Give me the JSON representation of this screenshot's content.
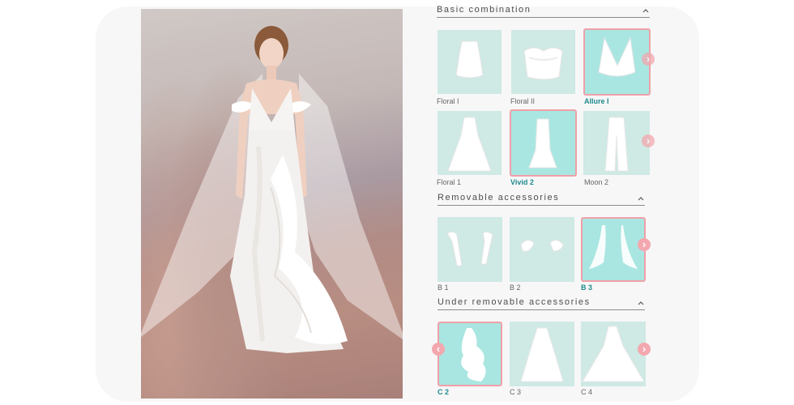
{
  "sections": {
    "basic": {
      "title": "Basic combination"
    },
    "removable": {
      "title": "Removable accessories"
    },
    "under": {
      "title": "Under removable accessories"
    }
  },
  "tops": [
    {
      "label": "Floral I",
      "selected": false,
      "icon": "halter-top-icon"
    },
    {
      "label": "Floral II",
      "selected": false,
      "icon": "bustier-top-icon"
    },
    {
      "label": "Allure I",
      "selected": true,
      "icon": "v-neck-top-icon"
    }
  ],
  "bottoms": [
    {
      "label": "Floral 1",
      "selected": false,
      "icon": "aline-skirt-icon"
    },
    {
      "label": "Vivid 2",
      "selected": true,
      "icon": "mermaid-skirt-icon"
    },
    {
      "label": "Moon 2",
      "selected": false,
      "icon": "wide-pants-icon"
    }
  ],
  "accessories": [
    {
      "label": "B 1",
      "selected": false,
      "icon": "ribbon-sleeves-icon"
    },
    {
      "label": "B 2",
      "selected": false,
      "icon": "cap-sleeves-icon"
    },
    {
      "label": "B 3",
      "selected": true,
      "icon": "cape-veil-icon"
    }
  ],
  "under_accessories": [
    {
      "label": "C 2",
      "selected": true,
      "icon": "ruffle-overskirt-icon"
    },
    {
      "label": "C 3",
      "selected": false,
      "icon": "tulle-overskirt-icon"
    },
    {
      "label": "C 4",
      "selected": false,
      "icon": "train-overskirt-icon"
    }
  ],
  "colors": {
    "card_bg": "#cfe9e4",
    "selected_card_bg": "#a9e6e1",
    "selected_border": "#f0a0a8",
    "selected_label": "#1f8a8d",
    "arrow_bg": "#f4a7ae"
  }
}
